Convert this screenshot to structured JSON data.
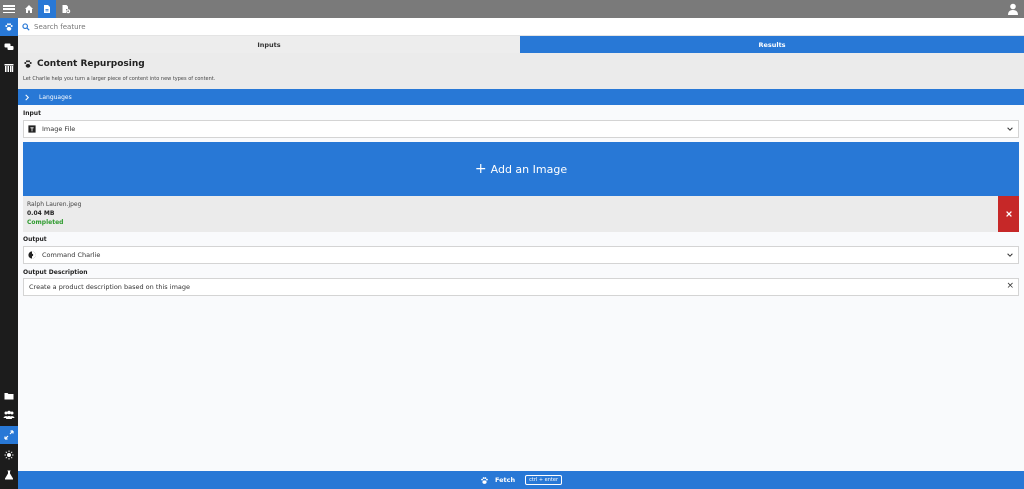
{
  "search": {
    "placeholder": "Search feature"
  },
  "tabs": [
    {
      "label": "Inputs"
    },
    {
      "label": "Results"
    }
  ],
  "header": {
    "title": "Content Repurposing",
    "subtitle": "Let Charlie help you turn a larger piece of content into new types of content."
  },
  "languages": {
    "label": "Languages"
  },
  "input": {
    "label": "Input",
    "selected": "Image File"
  },
  "add_image": {
    "label": "Add an Image"
  },
  "file": {
    "name": "Ralph Lauren.jpeg",
    "size": "0.04 MB",
    "status": "Completed"
  },
  "output": {
    "label": "Output",
    "selected": "Command Charlie"
  },
  "output_description": {
    "label": "Output Description",
    "value": "Create a product description based on this image"
  },
  "footer": {
    "fetch_label": "Fetch",
    "shortcut": "ctrl + enter"
  },
  "colors": {
    "accent": "#2878d6",
    "danger": "#c62828",
    "success": "#2e9b2e"
  }
}
